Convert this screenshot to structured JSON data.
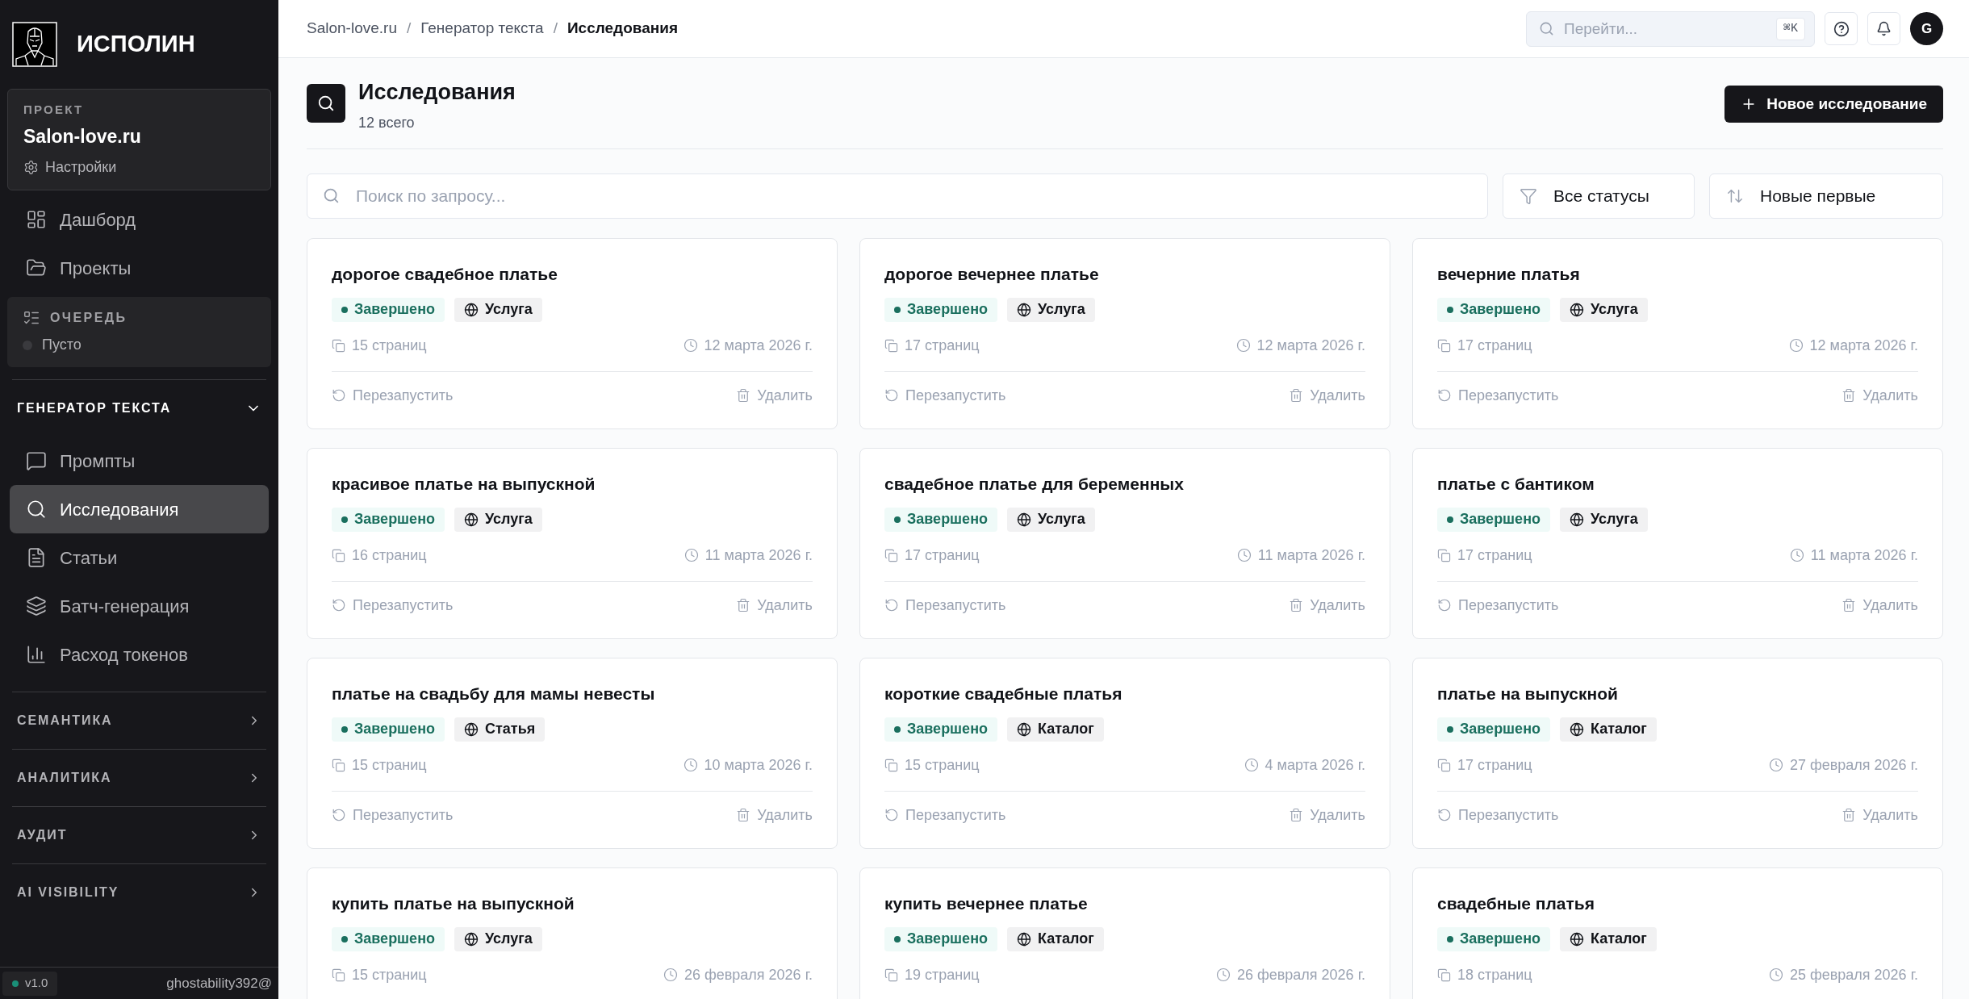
{
  "sidebar": {
    "brand": "ИСПОЛИН",
    "project": {
      "label": "ПРОЕКТ",
      "name": "Salon-love.ru",
      "settings": "Настройки"
    },
    "nav": [
      {
        "label": "Дашборд",
        "selected": false
      },
      {
        "label": "Проекты",
        "selected": false
      }
    ],
    "queue": {
      "label": "ОЧЕРЕДЬ",
      "status": "Пусто"
    },
    "sections": [
      {
        "title": "ГЕНЕРАТОР ТЕКСТА",
        "expanded": true,
        "items": [
          {
            "label": "Промпты",
            "selected": false
          },
          {
            "label": "Исследования",
            "selected": true
          },
          {
            "label": "Статьи",
            "selected": false
          },
          {
            "label": "Батч-генерация",
            "selected": false
          },
          {
            "label": "Расход токенов",
            "selected": false
          }
        ]
      },
      {
        "title": "СЕМАНТИКА",
        "expanded": false
      },
      {
        "title": "АНАЛИТИКА",
        "expanded": false
      },
      {
        "title": "АУДИТ",
        "expanded": false
      },
      {
        "title": "AI VISIBILITY",
        "expanded": false
      }
    ],
    "footer": {
      "version": "v1.0",
      "user": "ghostability392@"
    }
  },
  "topbar": {
    "breadcrumbs": [
      "Salon-love.ru",
      "Генератор текста",
      "Исследования"
    ],
    "breadcrumb_separators": [
      "/",
      "/"
    ],
    "search": {
      "placeholder": "Перейти...",
      "shortcut": "⌘K"
    },
    "avatar": "G"
  },
  "page": {
    "title": "Исследования",
    "count": "12 всего",
    "new_button": "Новое исследование",
    "search": {
      "placeholder": "Поиск по запросу..."
    },
    "status_filter": "Все статусы",
    "sort": "Новые первые"
  },
  "cards": [
    {
      "title": "дорогое свадебное платье",
      "status": {
        "label": "Завершено",
        "kind": "done"
      },
      "type": "Услуга",
      "pages": "15 страниц",
      "date": "12 марта 2026 г.",
      "actions": [
        "Перезапустить",
        "Удалить"
      ]
    },
    {
      "title": "дорогое вечернее платье",
      "status": {
        "label": "Завершено",
        "kind": "done"
      },
      "type": "Услуга",
      "pages": "17 страниц",
      "date": "12 марта 2026 г.",
      "actions": [
        "Перезапустить",
        "Удалить"
      ]
    },
    {
      "title": "вечерние платья",
      "status": {
        "label": "Завершено",
        "kind": "done"
      },
      "type": "Услуга",
      "pages": "17 страниц",
      "date": "12 марта 2026 г.",
      "actions": [
        "Перезапустить",
        "Удалить"
      ]
    },
    {
      "title": "красивое платье на выпускной",
      "status": {
        "label": "Завершено",
        "kind": "done"
      },
      "type": "Услуга",
      "pages": "16 страниц",
      "date": "11 марта 2026 г.",
      "actions": [
        "Перезапустить",
        "Удалить"
      ]
    },
    {
      "title": "свадебное платье для беременных",
      "status": {
        "label": "Завершено",
        "kind": "done"
      },
      "type": "Услуга",
      "pages": "17 страниц",
      "date": "11 марта 2026 г.",
      "actions": [
        "Перезапустить",
        "Удалить"
      ]
    },
    {
      "title": "платье с бантиком",
      "status": {
        "label": "Завершено",
        "kind": "done"
      },
      "type": "Услуга",
      "pages": "17 страниц",
      "date": "11 марта 2026 г.",
      "actions": [
        "Перезапустить",
        "Удалить"
      ]
    },
    {
      "title": "платье на свадьбу для мамы невесты",
      "status": {
        "label": "Завершено",
        "kind": "done"
      },
      "type": "Статья",
      "pages": "15 страниц",
      "date": "10 марта 2026 г.",
      "actions": [
        "Перезапустить",
        "Удалить"
      ]
    },
    {
      "title": "короткие свадебные платья",
      "status": {
        "label": "Завершено",
        "kind": "done"
      },
      "type": "Каталог",
      "pages": "15 страниц",
      "date": "4 марта 2026 г.",
      "actions": [
        "Перезапустить",
        "Удалить"
      ]
    },
    {
      "title": "платье на выпускной",
      "status": {
        "label": "Завершено",
        "kind": "done"
      },
      "type": "Каталог",
      "pages": "17 страниц",
      "date": "27 февраля 2026 г.",
      "actions": [
        "Перезапустить",
        "Удалить"
      ]
    },
    {
      "title": "купить платье на выпускной",
      "status": {
        "label": "Завершено",
        "kind": "done"
      },
      "type": "Услуга",
      "pages": "15 страниц",
      "date": "26 февраля 2026 г."
    },
    {
      "title": "купить вечернее платье",
      "status": {
        "label": "Завершено",
        "kind": "done"
      },
      "type": "Каталог",
      "pages": "19 страниц",
      "date": "26 февраля 2026 г."
    },
    {
      "title": "свадебные платья",
      "status": {
        "label": "Завершено",
        "kind": "done"
      },
      "type": "Каталог",
      "pages": "18 страниц",
      "date": "25 февраля 2026 г."
    }
  ]
}
